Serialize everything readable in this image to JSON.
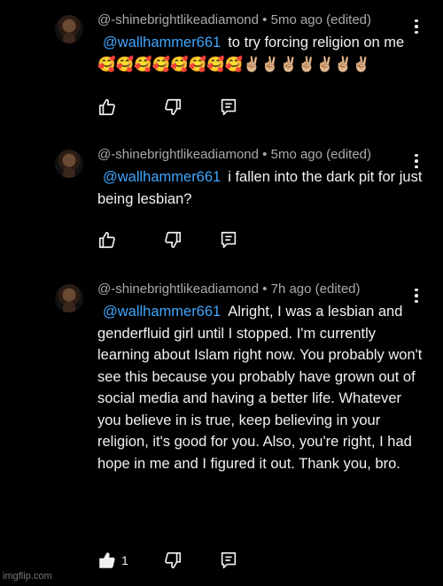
{
  "comments": [
    {
      "author": "@-shinebrightlikeadiamond",
      "time": "5mo ago (edited)",
      "mention": "@wallhammer661",
      "text": "to try forcing religion on me 🥰🥰🥰🥰🥰🥰🥰🥰✌🏼✌🏼✌🏼✌🏼✌🏼✌🏼✌🏼",
      "likes": ""
    },
    {
      "author": "@-shinebrightlikeadiamond",
      "time": "5mo ago (edited)",
      "mention": "@wallhammer661",
      "text": "i fallen into the dark pit for just being lesbian?",
      "likes": ""
    },
    {
      "author": "@-shinebrightlikeadiamond",
      "time": "7h ago (edited)",
      "mention": "@wallhammer661",
      "text": "Alright, I was a lesbian and genderfluid girl until I stopped. I'm currently learning about Islam right now. You probably won't see this because you probably have grown out of social media and having a better life. Whatever you believe in is true, keep believing in your religion, it's good for you. Also, you're right, I had hope in me and I figured it out. Thank you, bro.",
      "likes": "1"
    }
  ],
  "separator": "•",
  "watermark": "imgflip.com",
  "icons": [
    "avatar",
    "more-vert-icon",
    "thumb-up-icon",
    "thumb-down-icon",
    "reply-icon"
  ]
}
